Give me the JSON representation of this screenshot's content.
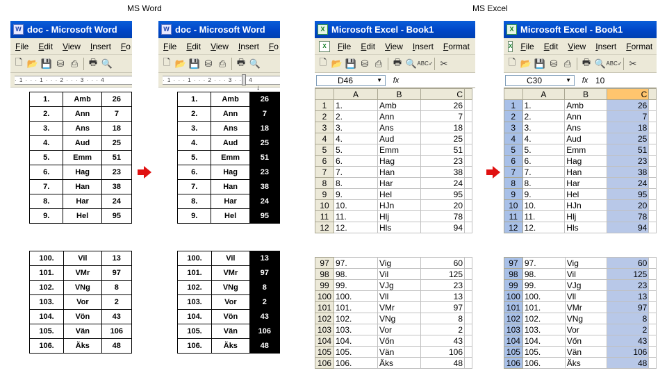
{
  "headings": {
    "word": "MS Word",
    "excel": "MS Excel"
  },
  "word": {
    "title": "doc - Microsoft Word",
    "menu": [
      "File",
      "Edit",
      "View",
      "Insert",
      "Fo"
    ],
    "ruler_text": "· 1 · · · 1 · · · 2 · · · 3 · · · 4",
    "rows_top": [
      [
        "1.",
        "Amb",
        "26"
      ],
      [
        "2.",
        "Ann",
        "7"
      ],
      [
        "3.",
        "Ans",
        "18"
      ],
      [
        "4.",
        "Aud",
        "25"
      ],
      [
        "5.",
        "Emm",
        "51"
      ],
      [
        "6.",
        "Hag",
        "23"
      ],
      [
        "7.",
        "Han",
        "38"
      ],
      [
        "8.",
        "Har",
        "24"
      ],
      [
        "9.",
        "Hel",
        "95"
      ]
    ],
    "rows_bottom": [
      [
        "100.",
        "Vil",
        "13"
      ],
      [
        "101.",
        "VMr",
        "97"
      ],
      [
        "102.",
        "VNg",
        "8"
      ],
      [
        "103.",
        "Vor",
        "2"
      ],
      [
        "104.",
        "Vön",
        "43"
      ],
      [
        "105.",
        "Vän",
        "106"
      ],
      [
        "106.",
        "Äks",
        "48"
      ]
    ]
  },
  "excel": {
    "title": "Microsoft Excel - Book1",
    "menu": [
      "File",
      "Edit",
      "View",
      "Insert",
      "Format"
    ],
    "left_namebox": "D46",
    "right_namebox": "C30",
    "right_formula": "10",
    "fx": "fx",
    "columns": [
      "A",
      "B",
      "C"
    ],
    "rows_top": [
      [
        "1",
        "1.",
        "Amb",
        "26"
      ],
      [
        "2",
        "2.",
        "Ann",
        "7"
      ],
      [
        "3",
        "3.",
        "Ans",
        "18"
      ],
      [
        "4",
        "4.",
        "Aud",
        "25"
      ],
      [
        "5",
        "5.",
        "Emm",
        "51"
      ],
      [
        "6",
        "6.",
        "Hag",
        "23"
      ],
      [
        "7",
        "7.",
        "Han",
        "38"
      ],
      [
        "8",
        "8.",
        "Har",
        "24"
      ],
      [
        "9",
        "9.",
        "Hel",
        "95"
      ],
      [
        "10",
        "10.",
        "HJn",
        "20"
      ],
      [
        "11",
        "11.",
        "Hlj",
        "78"
      ],
      [
        "12",
        "12.",
        "Hls",
        "94"
      ]
    ],
    "rows_bottom": [
      [
        "97",
        "97.",
        "Vig",
        "60"
      ],
      [
        "98",
        "98.",
        "Vil",
        "125"
      ],
      [
        "99",
        "99.",
        "VJg",
        "23"
      ],
      [
        "100",
        "100.",
        "Vll",
        "13"
      ],
      [
        "101",
        "101.",
        "VMr",
        "97"
      ],
      [
        "102",
        "102.",
        "VNg",
        "8"
      ],
      [
        "103",
        "103.",
        "Vor",
        "2"
      ],
      [
        "104",
        "104.",
        "Vőn",
        "43"
      ],
      [
        "105",
        "105.",
        "Vän",
        "106"
      ],
      [
        "106",
        "106.",
        "Äks",
        "48"
      ]
    ]
  },
  "icons": [
    "word-app-icon",
    "excel-app-icon",
    "new-icon",
    "open-icon",
    "save-icon",
    "permission-icon",
    "print-preview-icon",
    "print-icon",
    "spelling-icon",
    "cut-icon",
    "red-arrow-icon",
    "down-arrow-icon"
  ],
  "colors": {
    "titlebar": "#0046c8",
    "selection_word": "#000000",
    "selection_excel": "#b8c8e8",
    "arrow": "#e01010"
  }
}
